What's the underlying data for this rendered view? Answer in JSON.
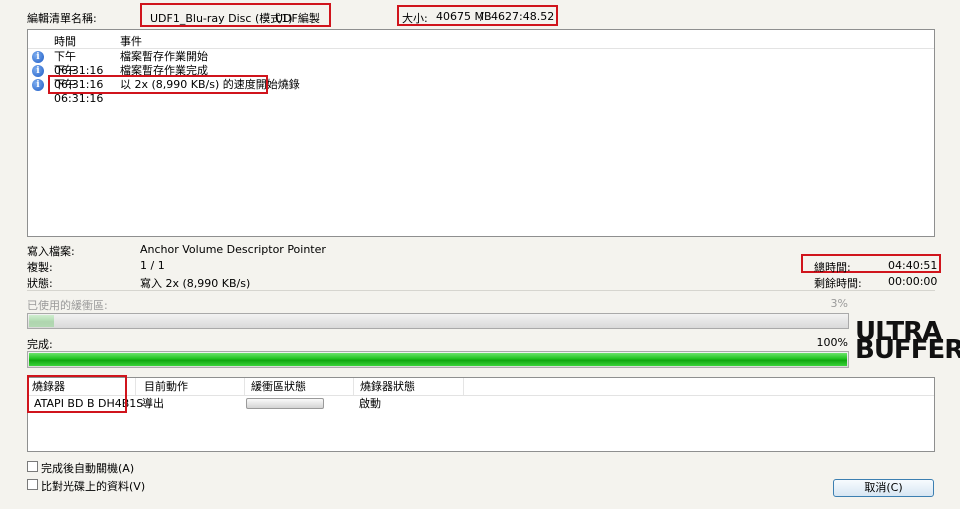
{
  "top": {
    "label": "編輯清單名稱:",
    "disc_name": "UDF1_Blu-ray Disc (模式1)",
    "disc_format": "UDF編製",
    "size_label": "大小:",
    "size_value": "40675 MB",
    "size_sep": "/",
    "size_time": "4627:48.52"
  },
  "log": {
    "col_time": "時間",
    "col_event": "事件",
    "rows": [
      {
        "icon": "info-icon",
        "time": "下午 06:31:16",
        "event": "檔案暫存作業開始"
      },
      {
        "icon": "info-icon",
        "time": "下午 06:31:16",
        "event": "檔案暫存作業完成"
      },
      {
        "icon": "info-icon",
        "time": "下午 06:31:16",
        "event": "以 2x (8,990 KB/s) 的速度開始燒錄"
      }
    ]
  },
  "status": {
    "write_label": "寫入檔案:",
    "write_value": "Anchor Volume Descriptor Pointer",
    "copy_label": "複製:",
    "copy_value": "1 / 1",
    "state_label": "狀態:",
    "state_value": "寫入 2x (8,990 KB/s)",
    "total_label": "總時間:",
    "total_value": "04:40:51",
    "remain_label": "剩餘時間:",
    "remain_value": "00:00:00"
  },
  "buffer": {
    "label": "已使用的緩衝區:",
    "percent_text": "3%",
    "level": 0.03
  },
  "complete": {
    "label": "完成:",
    "percent_text": "100%",
    "level": 1.0
  },
  "logo": {
    "line1": "ULTRA",
    "line2": "BUFFER"
  },
  "recorders": {
    "col_recorder": "燒錄器",
    "col_action": "目前動作",
    "col_buffer": "緩衝區狀態",
    "col_state": "燒錄器狀態",
    "rows": [
      {
        "recorder": "ATAPI BD  B  DH4B1S",
        "action": "導出",
        "buffer_level": 0,
        "state": "啟動"
      }
    ]
  },
  "options": {
    "auto_shutdown": "完成後自動關機(A)",
    "verify": "比對光碟上的資料(V)"
  },
  "buttons": {
    "cancel": "取消(C)"
  },
  "colors": {
    "highlight": "#d0141c",
    "progress": "#1fc21f"
  }
}
